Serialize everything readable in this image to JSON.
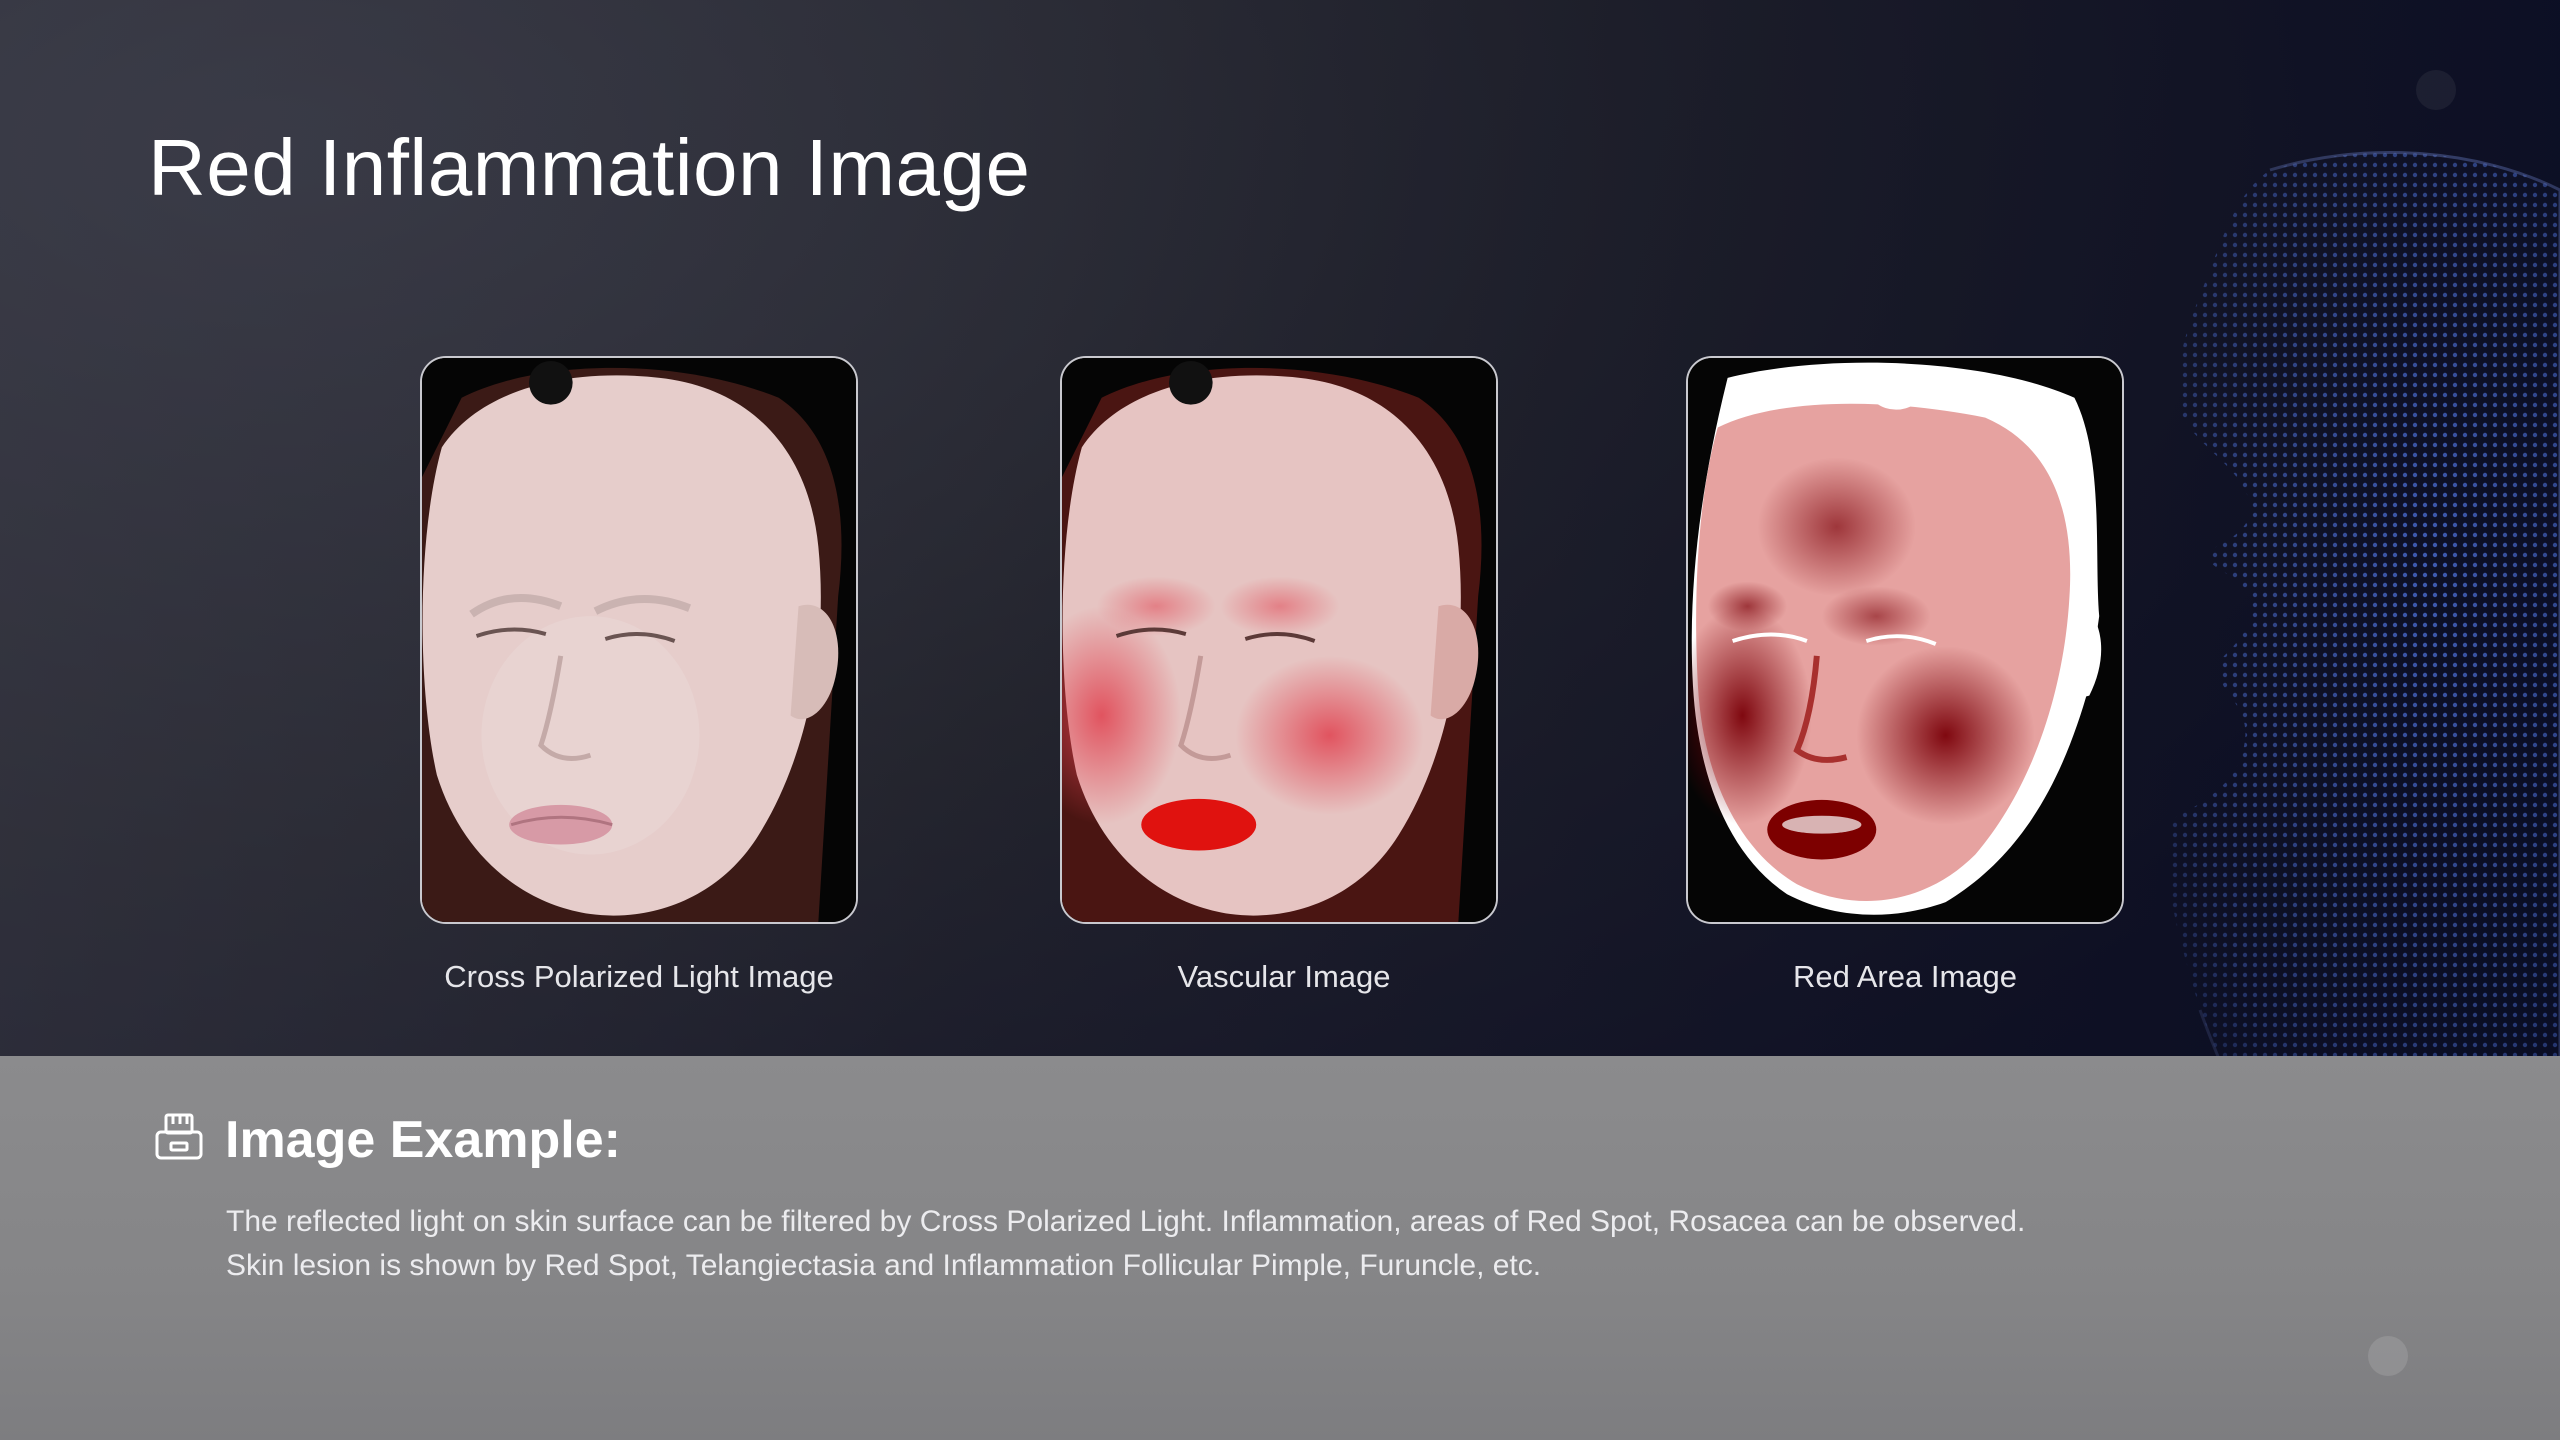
{
  "title": "Red Inflammation Image",
  "images": [
    {
      "caption": "Cross Polarized Light Image",
      "icon": "face-photo-cross-polarized"
    },
    {
      "caption": "Vascular Image",
      "icon": "face-photo-vascular"
    },
    {
      "caption": "Red Area Image",
      "icon": "face-photo-red-area"
    }
  ],
  "example": {
    "icon": "printer-icon",
    "title": "Image Example:",
    "lines": [
      "The reflected light on skin surface can be filtered by Cross Polarized Light. Inflammation, areas of Red Spot, Rosacea can be observed.",
      "Skin lesion is shown by Red Spot, Telangiectasia and Inflammation Follicular Pimple, Furuncle, etc."
    ]
  },
  "colors": {
    "background": "#25262f",
    "panel": "#878789",
    "accent_blue": "#3b5fc8",
    "inflammation_red": "#c0242a"
  }
}
